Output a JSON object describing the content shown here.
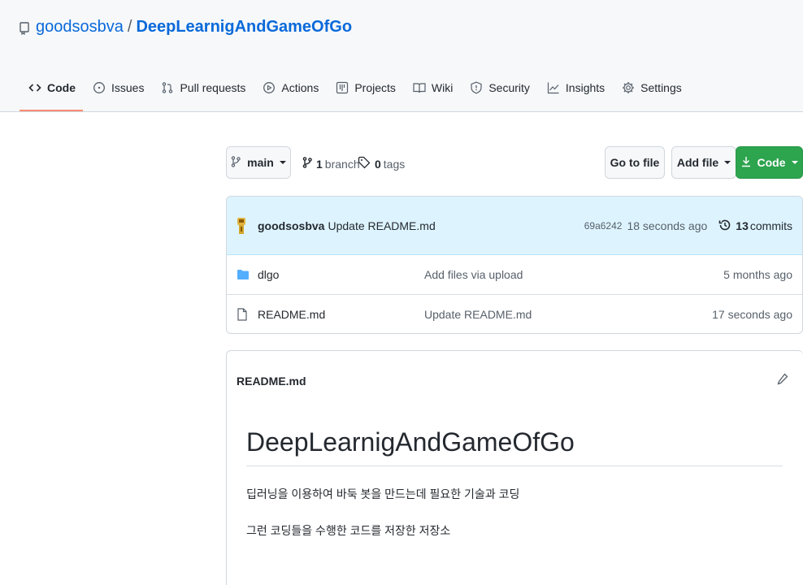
{
  "repo": {
    "owner": "goodsosbva",
    "separator": "/",
    "name": "DeepLearnigAndGameOfGo"
  },
  "tabs": [
    {
      "label": "Code",
      "icon": "code-icon",
      "active": true
    },
    {
      "label": "Issues",
      "icon": "issue-icon"
    },
    {
      "label": "Pull requests",
      "icon": "pull-request-icon"
    },
    {
      "label": "Actions",
      "icon": "play-icon"
    },
    {
      "label": "Projects",
      "icon": "table-icon"
    },
    {
      "label": "Wiki",
      "icon": "book-icon"
    },
    {
      "label": "Security",
      "icon": "shield-icon"
    },
    {
      "label": "Insights",
      "icon": "graph-icon"
    },
    {
      "label": "Settings",
      "icon": "gear-icon"
    }
  ],
  "toolbar": {
    "branch": "main",
    "branch_count": "1",
    "branch_word": "branch",
    "tag_count": "0",
    "tag_word": "tags",
    "go_to_file": "Go to file",
    "add_file": "Add file",
    "code": "Code"
  },
  "latest_commit": {
    "user": "goodsosbva",
    "message": "Update README.md",
    "sha": "69a6242",
    "time": "18 seconds ago",
    "count": "13",
    "count_word": "commits"
  },
  "files": [
    {
      "name": "dlgo",
      "type": "folder",
      "message": "Add files via upload",
      "age": "5 months ago"
    },
    {
      "name": "README.md",
      "type": "file",
      "message": "Update README.md",
      "age": "17 seconds ago"
    }
  ],
  "readme": {
    "filename": "README.md",
    "heading": "DeepLearnigAndGameOfGo",
    "paragraphs": [
      "딥러닝을 이용하여 바둑 봇을 만드는데 필요한 기술과 코딩",
      "그런 코딩들을 수행한 코드를 저장한 저장소"
    ]
  },
  "colors": {
    "link": "#0969da",
    "accent_underline": "#fd8c73",
    "primary_button": "#2da44e",
    "commit_banner": "#ddf4ff",
    "folder": "#54aeff"
  }
}
